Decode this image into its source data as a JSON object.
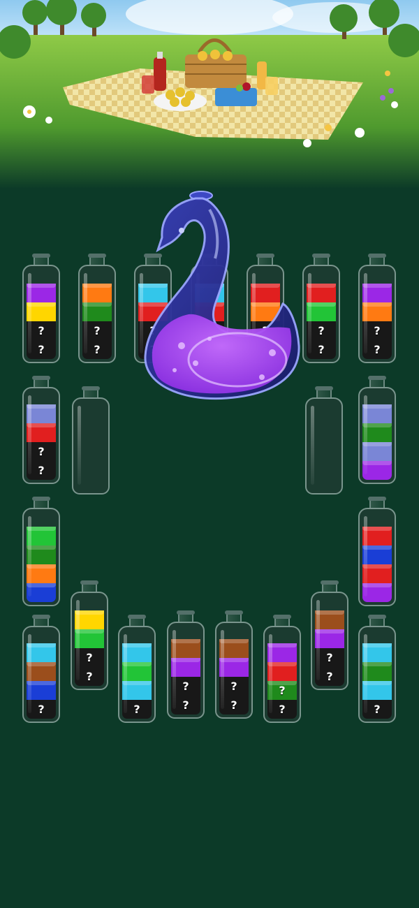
{
  "game": {
    "title": "",
    "hidden_marker": "?",
    "colors": {
      "purple": "#9b27e6",
      "yellow": "#ffd600",
      "orange": "#ff7a12",
      "green_dark": "#1f8a1c",
      "green": "#22c437",
      "cyan": "#33c6ea",
      "red": "#e11f1f",
      "blue": "#1a3ed6",
      "periwinkle": "#7a86d6",
      "brown": "#9b4e1c",
      "hidden": "#181818"
    },
    "bottles": [
      {
        "id": "b1",
        "layers": [
          "purple",
          "yellow",
          "hidden",
          "hidden"
        ]
      },
      {
        "id": "b2",
        "layers": [
          "orange",
          "green_dark",
          "hidden",
          "hidden"
        ]
      },
      {
        "id": "b3",
        "layers": [
          "cyan",
          "red",
          "hidden",
          "hidden"
        ]
      },
      {
        "id": "b4",
        "layers": [
          "cyan",
          "red",
          "hidden",
          "hidden"
        ]
      },
      {
        "id": "b5",
        "layers": [
          "red",
          "orange",
          "hidden",
          "hidden"
        ]
      },
      {
        "id": "b6",
        "layers": [
          "red",
          "green",
          "hidden",
          "hidden"
        ]
      },
      {
        "id": "b7",
        "layers": [
          "purple",
          "orange",
          "hidden",
          "hidden"
        ]
      },
      {
        "id": "b8",
        "layers": [
          "periwinkle",
          "red",
          "hidden",
          "hidden"
        ]
      },
      {
        "id": "b9",
        "layers": []
      },
      {
        "id": "b10",
        "layers": []
      },
      {
        "id": "b11",
        "layers": [
          "periwinkle",
          "green_dark",
          "periwinkle",
          "purple"
        ]
      },
      {
        "id": "b12",
        "layers": [
          "green",
          "green_dark",
          "orange",
          "blue"
        ]
      },
      {
        "id": "b13",
        "layers": [
          "red",
          "blue",
          "red",
          "purple"
        ]
      },
      {
        "id": "b14",
        "layers": [
          "yellow",
          "green",
          "hidden",
          "hidden"
        ]
      },
      {
        "id": "b15",
        "layers": [
          "brown",
          "purple",
          "hidden",
          "hidden"
        ]
      },
      {
        "id": "b16",
        "layers": [
          "cyan",
          "brown",
          "blue",
          "hidden"
        ]
      },
      {
        "id": "b17",
        "layers": [
          "cyan",
          "green",
          "cyan",
          "hidden"
        ]
      },
      {
        "id": "b18",
        "layers": [
          "brown",
          "purple",
          "hidden",
          "hidden"
        ]
      },
      {
        "id": "b19",
        "layers": [
          "brown",
          "purple",
          "hidden",
          "hidden"
        ]
      },
      {
        "id": "b20",
        "layers": [
          "purple",
          "red",
          "hidden_green",
          "hidden"
        ]
      },
      {
        "id": "b21",
        "layers": [
          "cyan",
          "green_dark",
          "cyan",
          "hidden"
        ]
      }
    ],
    "mystery_vessel": {
      "name": "swan-flask",
      "liquid_color": "#8a2be2"
    }
  }
}
